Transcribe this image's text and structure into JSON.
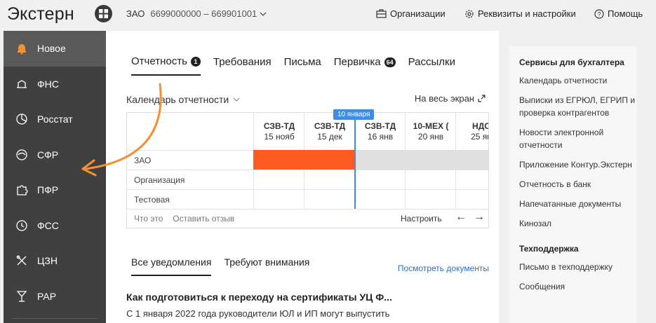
{
  "header": {
    "logo": "Экстерн",
    "org_name": "ЗАО",
    "org_inn": "6699000000 – 669901001",
    "links": [
      {
        "label": "Организации",
        "icon": "building-icon"
      },
      {
        "label": "Реквизиты и настройки",
        "icon": "gear-icon"
      },
      {
        "label": "Помощь",
        "icon": "help-icon"
      }
    ]
  },
  "sidebar": {
    "items": [
      {
        "label": "Новое",
        "icon": "bell-icon",
        "active": true
      },
      {
        "label": "ФНС",
        "icon": "fns-icon"
      },
      {
        "label": "Росстат",
        "icon": "pie-icon"
      },
      {
        "label": "СФР",
        "icon": "gauge-icon"
      },
      {
        "label": "ПФР",
        "icon": "puzzle-icon"
      },
      {
        "label": "ФСС",
        "icon": "clock-icon"
      },
      {
        "label": "ЦЗН",
        "icon": "tools-icon"
      },
      {
        "label": "РАР",
        "icon": "glass-icon"
      }
    ]
  },
  "tabs": [
    {
      "label": "Отчетность",
      "badge": "1",
      "active": true
    },
    {
      "label": "Требования",
      "badge": null
    },
    {
      "label": "Письма",
      "badge": null
    },
    {
      "label": "Первичка",
      "badge": "64"
    },
    {
      "label": "Рассылки",
      "badge": null
    }
  ],
  "calendar": {
    "title": "Календарь отчетности",
    "fullscreen": "На весь экран",
    "today_label": "10 января",
    "columns": [
      {
        "name": "СЗВ-ТД",
        "date": "15 нояб"
      },
      {
        "name": "СЗВ-ТД",
        "date": "15 дек"
      },
      {
        "name": "СЗВ-ТД",
        "date": "16 янв"
      },
      {
        "name": "10-МЕХ (",
        "date": "20 янв"
      },
      {
        "name": "НДС",
        "date": "25 ян"
      }
    ],
    "rows": [
      "ЗАО",
      "Организация",
      "Тестовая"
    ],
    "footer_what": "Что это",
    "footer_feedback": "Оставить отзыв",
    "setup": "Настроить"
  },
  "notifications": {
    "tabs": [
      {
        "label": "Все уведомления",
        "active": true
      },
      {
        "label": "Требуют внимания",
        "active": false
      }
    ],
    "view_docs": "Посмотреть документы",
    "news_title": "Как подготовиться к переходу на сертификаты УЦ Ф...",
    "news_text": "С 1 января 2022 года руководители ЮЛ и ИП могут выпустить"
  },
  "right_panel": {
    "services_title": "Сервисы для бухгалтера",
    "services": [
      "Календарь отчетности",
      "Выписки из ЕГРЮЛ, ЕГРИП и проверка контрагентов",
      "Новости электронной отчетности",
      "Приложение Контур.Экстерн",
      "Отчетность в банк",
      "Напечатанные документы",
      "Кинозал"
    ],
    "support_title": "Техподдержка",
    "support": [
      "Письмо в техподдержку",
      "Сообщения"
    ]
  },
  "colors": {
    "accent": "#fe5a21",
    "today": "#3f8ce0",
    "sidebar": "#404040",
    "arrow": "#f39233"
  }
}
